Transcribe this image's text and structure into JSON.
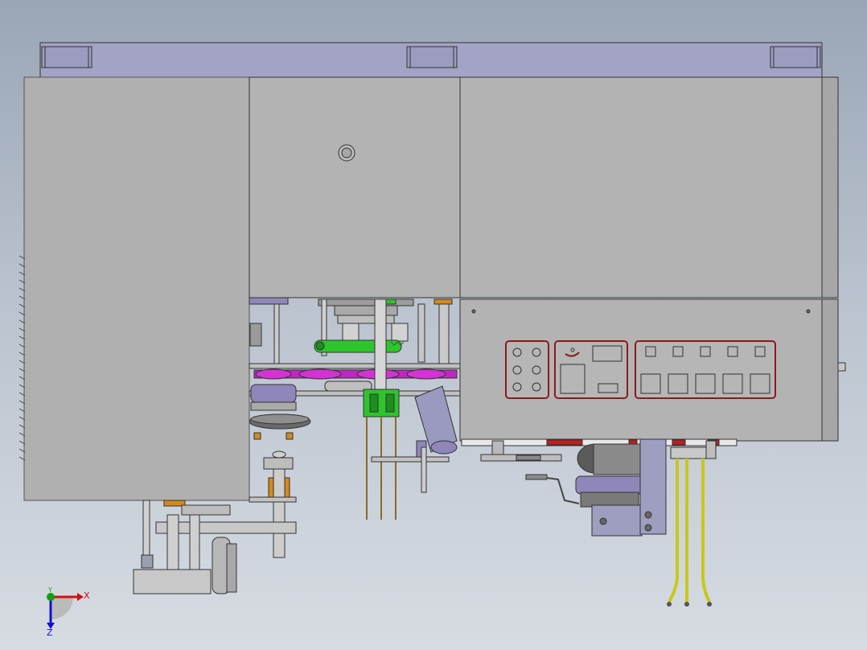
{
  "viewport": {
    "background_top": "#9aa6b6",
    "background_bottom": "#d7dce2"
  },
  "colors": {
    "panel": "#b3b3b3",
    "panel_dark": "#a7a7a7",
    "frame_top": "#a3a3c6",
    "rod": "#c4c4c4",
    "green_part": "#2ec42e",
    "magenta_belt": "#c027c0",
    "orange_part": "#d48a1b",
    "yellow_hose": "#dddd22",
    "purple_part": "#8f86b9",
    "red_outline": "#8b1a1a",
    "edge": "#333333"
  },
  "control_panels": [
    {
      "name": "indicator-lamps",
      "lamps": 6
    },
    {
      "name": "display-panel",
      "switch": 1,
      "displays": 3
    },
    {
      "name": "button-panel",
      "small_buttons": 5,
      "large_buttons": 5
    }
  ],
  "coordinate_triad": {
    "x_label": "X",
    "y_label": "Y",
    "z_label": "Z",
    "x_color": "#d01010",
    "y_color": "#10a010",
    "z_color": "#1010d0"
  }
}
